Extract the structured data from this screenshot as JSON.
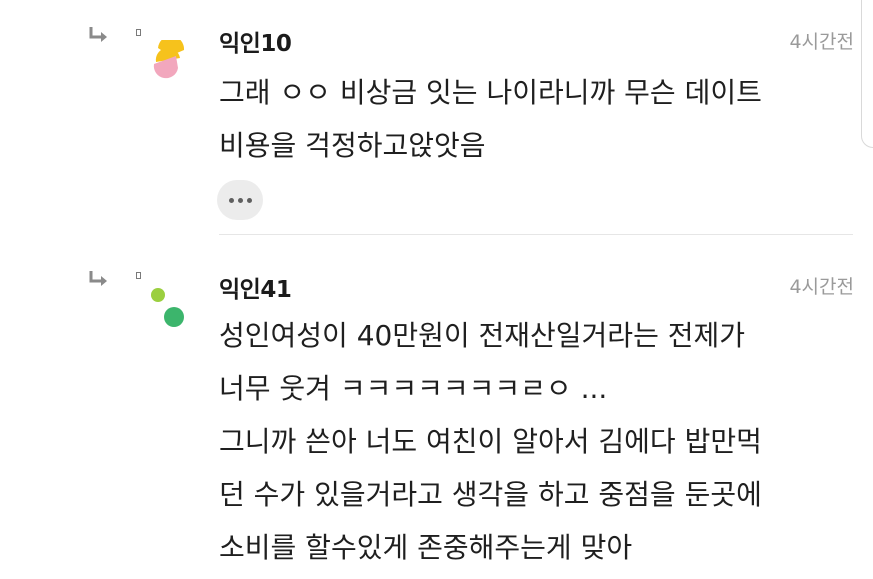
{
  "comments": [
    {
      "author": "익인10",
      "time": "4시간전",
      "lines": [
        "그래 ㅇㅇ 비상금 잇는 나이라니까 무슨 데이트",
        "비용을 걱정하고앉앗음"
      ],
      "avatar_colors": [
        "#f6c21c",
        "#f2a7bd"
      ],
      "more_label": "more-options"
    },
    {
      "author": "익인41",
      "time": "4시간전",
      "lines": [
        "성인여성이 40만원이 전재산일거라는 전제가",
        "너무 웃겨 ㅋㅋㅋㅋㅋㅋㅋㄹㅇ ...",
        "그니까 쓴아 너도 여친이 알아서 김에다 밥만먹",
        "던 수가 있을거라고 생각을 하고 중점을 둔곳에",
        "소비를 할수있게 존중해주는게 맞아"
      ],
      "avatar_colors": [
        "#9bcf3f",
        "#3cb56c"
      ]
    }
  ],
  "icons": {
    "reply": "reply-arrow-icon",
    "avatar": "avatar-icon",
    "more": "ellipsis-icon"
  },
  "colors": {
    "text": "#1f1f1f",
    "time": "#9a9a9a",
    "divider": "#e6e6e6",
    "more_bg": "#ececec"
  }
}
